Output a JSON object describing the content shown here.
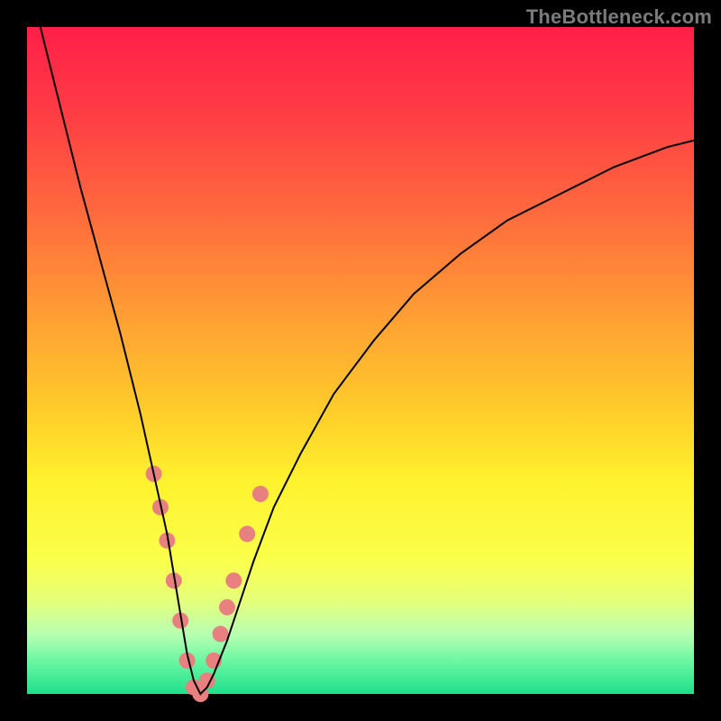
{
  "watermark": "TheBottleneck.com",
  "colors": {
    "frame": "#000000",
    "gradient_top": "#ff1f48",
    "gradient_bottom": "#1ee08a",
    "curve": "#000000",
    "marker": "#e98080"
  },
  "chart_data": {
    "type": "line",
    "title": "",
    "xlabel": "",
    "ylabel": "",
    "xlim": [
      0,
      100
    ],
    "ylim": [
      0,
      100
    ],
    "grid": false,
    "legend": false,
    "series": [
      {
        "name": "bottleneck-curve",
        "x": [
          2,
          5,
          8,
          11,
          14,
          17,
          19,
          21,
          22,
          23,
          24,
          25,
          26,
          27,
          28,
          30,
          32,
          34,
          37,
          41,
          46,
          52,
          58,
          65,
          72,
          80,
          88,
          96,
          100
        ],
        "values": [
          100,
          88,
          76,
          65,
          54,
          42,
          33,
          24,
          18,
          12,
          6,
          2,
          0,
          1,
          3,
          8,
          14,
          20,
          28,
          36,
          45,
          53,
          60,
          66,
          71,
          75,
          79,
          82,
          83
        ]
      }
    ],
    "markers": {
      "name": "highlighted-points",
      "points": [
        {
          "x": 19,
          "y": 33
        },
        {
          "x": 20,
          "y": 28
        },
        {
          "x": 21,
          "y": 23
        },
        {
          "x": 22,
          "y": 17
        },
        {
          "x": 23,
          "y": 11
        },
        {
          "x": 24,
          "y": 5
        },
        {
          "x": 25,
          "y": 1
        },
        {
          "x": 26,
          "y": 0
        },
        {
          "x": 27,
          "y": 2
        },
        {
          "x": 28,
          "y": 5
        },
        {
          "x": 29,
          "y": 9
        },
        {
          "x": 30,
          "y": 13
        },
        {
          "x": 31,
          "y": 17
        },
        {
          "x": 33,
          "y": 24
        },
        {
          "x": 35,
          "y": 30
        }
      ]
    }
  }
}
